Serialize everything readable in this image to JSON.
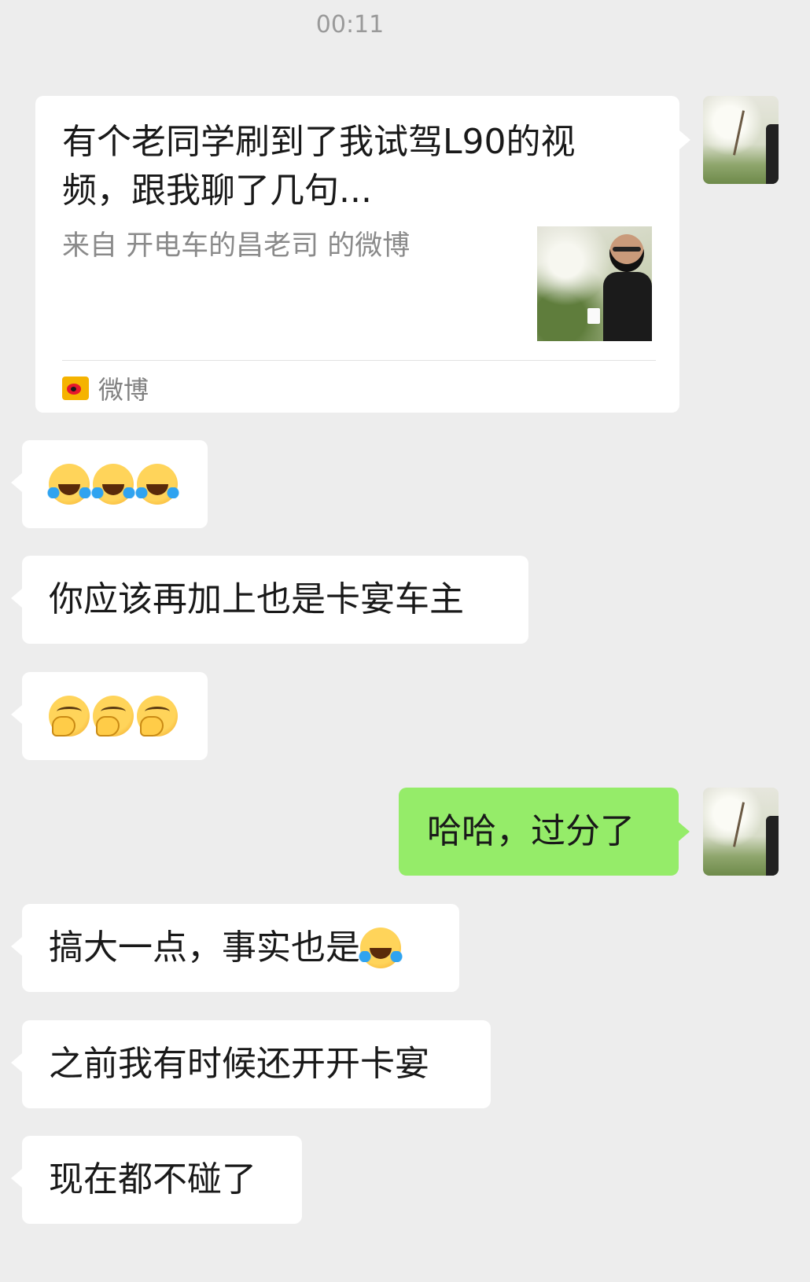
{
  "timestamp": "00:11",
  "share_card": {
    "title": "有个老同学刷到了我试驾L90的视频，跟我聊了几句...",
    "source_line": "来自 开电车的昌老司 的微博",
    "app_label": "微博",
    "app_icon": "weibo-icon"
  },
  "messages": [
    {
      "side": "in",
      "text": "",
      "emoji": [
        "joy-tears",
        "joy-tears",
        "joy-tears"
      ]
    },
    {
      "side": "in",
      "text": "你应该再加上也是卡宴车主",
      "emoji": []
    },
    {
      "side": "in",
      "text": "",
      "emoji": [
        "smirk",
        "smirk",
        "smirk"
      ]
    },
    {
      "side": "out",
      "text": "哈哈，过分了",
      "emoji": []
    },
    {
      "side": "in",
      "text": "搞大一点，事实也是",
      "emoji": [
        "joy-tears"
      ]
    },
    {
      "side": "in",
      "text": "之前我有时候还开开卡宴",
      "emoji": []
    },
    {
      "side": "in",
      "text": "现在都不碰了",
      "emoji": []
    }
  ],
  "colors": {
    "background": "#ededed",
    "incoming_bubble": "#ffffff",
    "outgoing_bubble": "#95ec69",
    "secondary_text": "#8a8a8a"
  }
}
